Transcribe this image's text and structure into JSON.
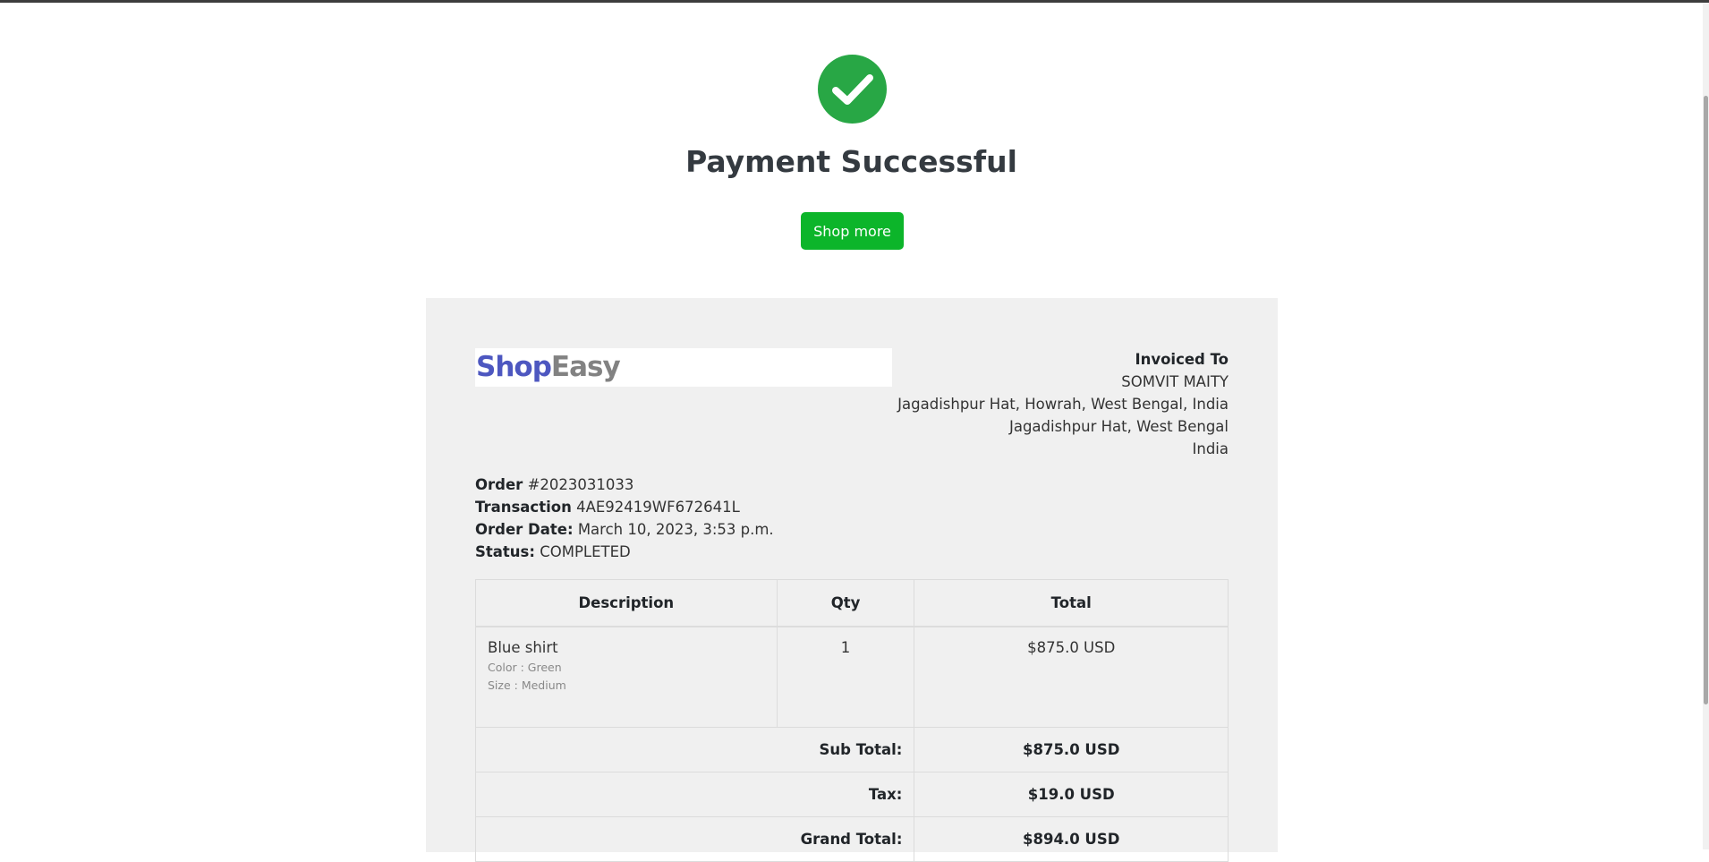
{
  "header": {
    "title": "Payment Successful",
    "shop_more_label": "Shop more"
  },
  "brand": {
    "name_part1": "Shop",
    "name_part2": "Easy",
    "color_part1": "#4d57c0",
    "color_part2": "#828282"
  },
  "invoiced_to": {
    "label": "Invoiced To",
    "lines": [
      "SOMVIT MAITY",
      "Jagadishpur Hat, Howrah, West Bengal, India",
      "Jagadishpur Hat, West Bengal",
      "India"
    ]
  },
  "order": {
    "order_label": "Order",
    "order_number": "#2023031033",
    "transaction_label": "Transaction",
    "transaction_id": "4AE92419WF672641L",
    "date_label": "Order Date:",
    "date_value": "March 10, 2023, 3:53 p.m.",
    "status_label": "Status:",
    "status_value": "COMPLETED"
  },
  "table": {
    "headers": [
      "Description",
      "Qty",
      "Total"
    ],
    "items": [
      {
        "name": "Blue shirt",
        "variations": [
          "Color : Green",
          "Size : Medium"
        ],
        "qty": "1",
        "total": "$875.0 USD"
      }
    ],
    "summary": [
      {
        "label": "Sub Total:",
        "value": "$875.0 USD"
      },
      {
        "label": "Tax:",
        "value": "$19.0 USD"
      },
      {
        "label": "Grand Total:",
        "value": "$894.0 USD"
      }
    ]
  },
  "colors": {
    "success": "#28a745",
    "button": "#0cb52a",
    "invoice_background": "#f0f0f0"
  },
  "icons": {
    "success": "check-circle-icon"
  }
}
